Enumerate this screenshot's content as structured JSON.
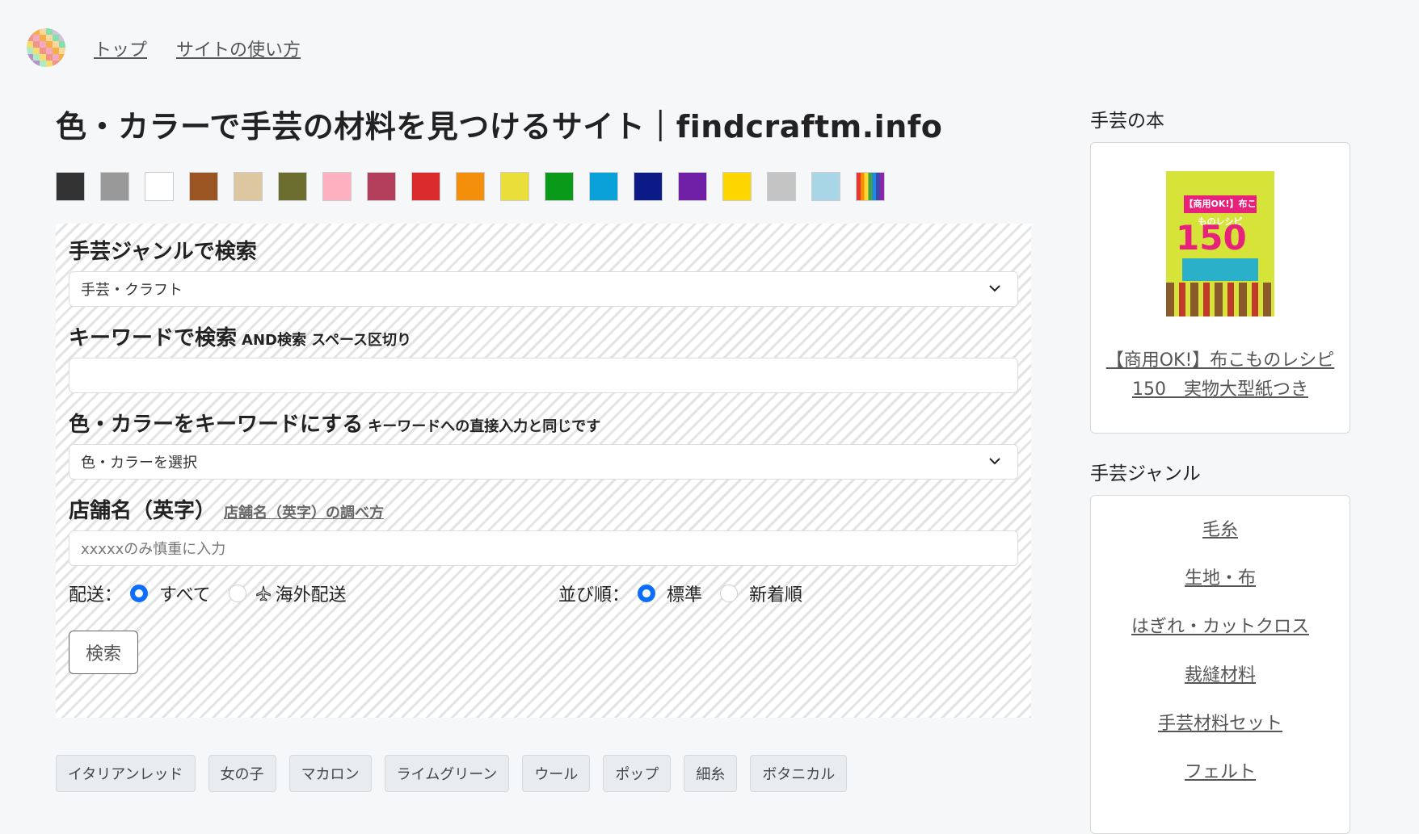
{
  "nav": {
    "top": "トップ",
    "howto": "サイトの使い方"
  },
  "page_title": "色・カラーで手芸の材料を見つけるサイト｜findcraftm.info",
  "swatches": [
    "#333333",
    "#999999",
    "#ffffff",
    "#9b5523",
    "#dcc7a0",
    "#6b6e2e",
    "#fdb1c0",
    "#b33e5c",
    "#d92b2b",
    "#f48f0b",
    "#e9de3a",
    "#0a9a1a",
    "#0aa1d8",
    "#0b1a86",
    "#6e1fa6",
    "#fdd600",
    "#c4c4c4",
    "#a9d6e7",
    "rainbow"
  ],
  "search": {
    "genre_label": "手芸ジャンルで検索",
    "genre_value": "手芸・クラフト",
    "keyword_label": "キーワードで検索",
    "keyword_hint": "AND検索 スペース区切り",
    "keyword_value": "",
    "color_label": "色・カラーをキーワードにする",
    "color_hint": "キーワードへの直接入力と同じです",
    "color_value": "色・カラーを選択",
    "shop_label": "店舗名（英字）",
    "shop_help_link": "店舗名（英字）の調べ方",
    "shop_placeholder": "xxxxxのみ慎重に入力",
    "shipping_label": "配送：",
    "shipping_all": "すべて",
    "shipping_overseas": "海外配送",
    "sort_label": "並び順：",
    "sort_standard": "標準",
    "sort_new": "新着順",
    "submit": "検索"
  },
  "tags": [
    "イタリアンレッド",
    "女の子",
    "マカロン",
    "ライムグリーン",
    "ウール",
    "ポップ",
    "細糸",
    "ボタニカル"
  ],
  "sidebar": {
    "book_heading": "手芸の本",
    "book_link_line1": "【商用OK!】布こものレシピ",
    "book_link_line2": "150　実物大型紙つき",
    "book_cover_badge": "【商用OK!】布こものレシピ",
    "book_cover_number": "150",
    "genre_heading": "手芸ジャンル",
    "genres": [
      "毛糸",
      "生地・布",
      "はぎれ・カットクロス",
      "裁縫材料",
      "手芸材料セット",
      "フェルト"
    ]
  }
}
